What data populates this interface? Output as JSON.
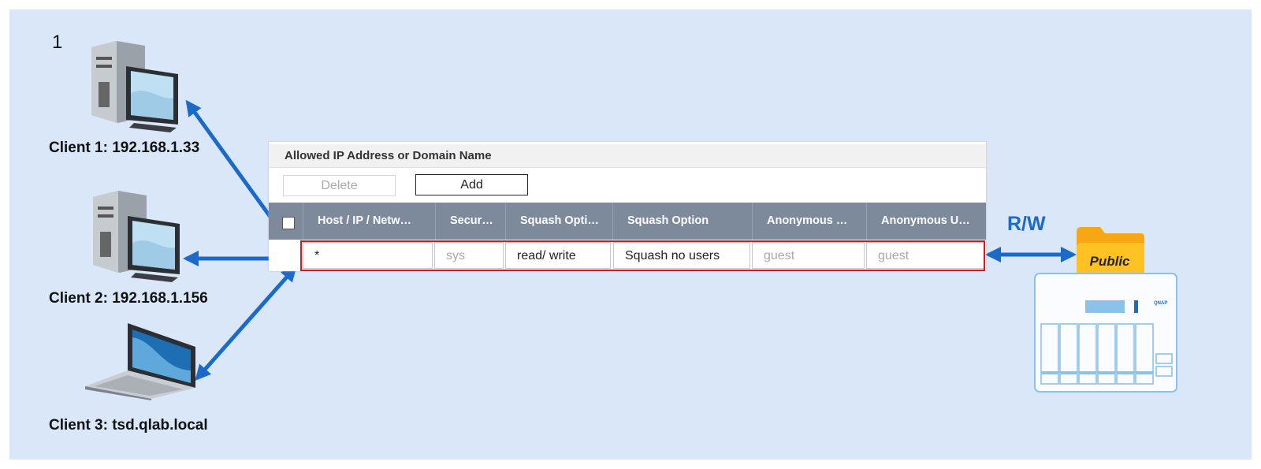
{
  "step_number": "1",
  "clients": [
    {
      "label": "Client 1: 192.168.1.33",
      "icon": "desktop-computer-icon"
    },
    {
      "label": "Client 2: 192.168.1.156",
      "icon": "desktop-computer-icon"
    },
    {
      "label": "Client 3: tsd.qlab.local",
      "icon": "laptop-icon"
    }
  ],
  "panel": {
    "title": "Allowed IP Address or Domain Name",
    "delete_label": "Delete",
    "add_label": "Add",
    "columns": [
      "Host / IP / Netw…",
      "Secur…",
      "Squash Opti…",
      "Squash Option",
      "Anonymous …",
      "Anonymous U…"
    ],
    "row": {
      "host": "*",
      "security": "sys",
      "permission": "read/ write",
      "squash": "Squash no users",
      "anon_gid": "guest",
      "anon_uid": "guest"
    }
  },
  "access_label": "R/W",
  "shared_folder": "Public",
  "nas_brand": "QNAP",
  "colors": {
    "background": "#d9e7f8",
    "arrow": "#1b6ac9",
    "highlight": "#d9151f",
    "header": "#7d8a9b",
    "folder": "#f7a614"
  }
}
